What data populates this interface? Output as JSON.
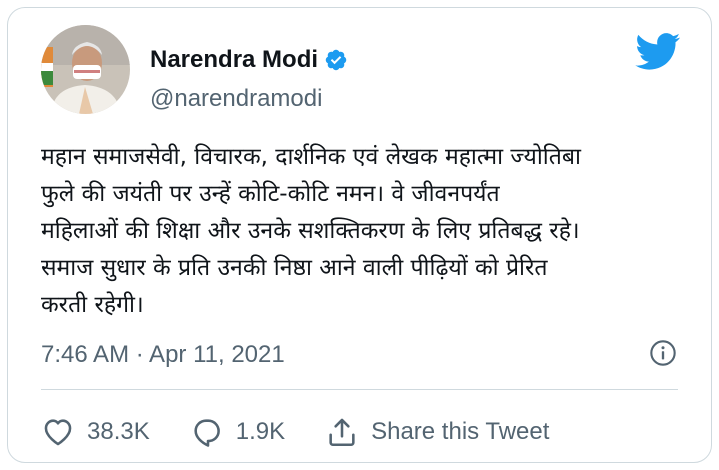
{
  "tweet": {
    "author_name": "Narendra Modi",
    "handle": "@narendramodi",
    "text_lines": [
      "महान समाजसेवी, विचारक, दार्शनिक एवं लेखक महात्मा ज्योतिबा",
      "फुले की जयंती पर उन्हें कोटि-कोटि नमन। वे जीवनपर्यंत",
      "महिलाओं की शिक्षा और उनके सशक्तिकरण के लिए प्रतिबद्ध रहे।",
      "समाज सुधार के प्रति उनकी निष्ठा आने वाली पीढ़ियों को प्रेरित",
      "करती रहेगी।"
    ],
    "timestamp": "7:46 AM · Apr 11, 2021"
  },
  "actions": {
    "likes": "38.3K",
    "replies": "1.9K",
    "share_label": "Share this Tweet"
  },
  "icons": {
    "verified": "verified-badge-icon",
    "brand": "twitter-bird-icon",
    "info": "info-icon",
    "like": "heart-icon",
    "reply": "speech-bubble-icon",
    "share": "share-upload-icon"
  },
  "colors": {
    "brand_blue": "#1d9bf0",
    "text_primary": "#0f1419",
    "text_secondary": "#536471",
    "border": "#cfd9de"
  }
}
